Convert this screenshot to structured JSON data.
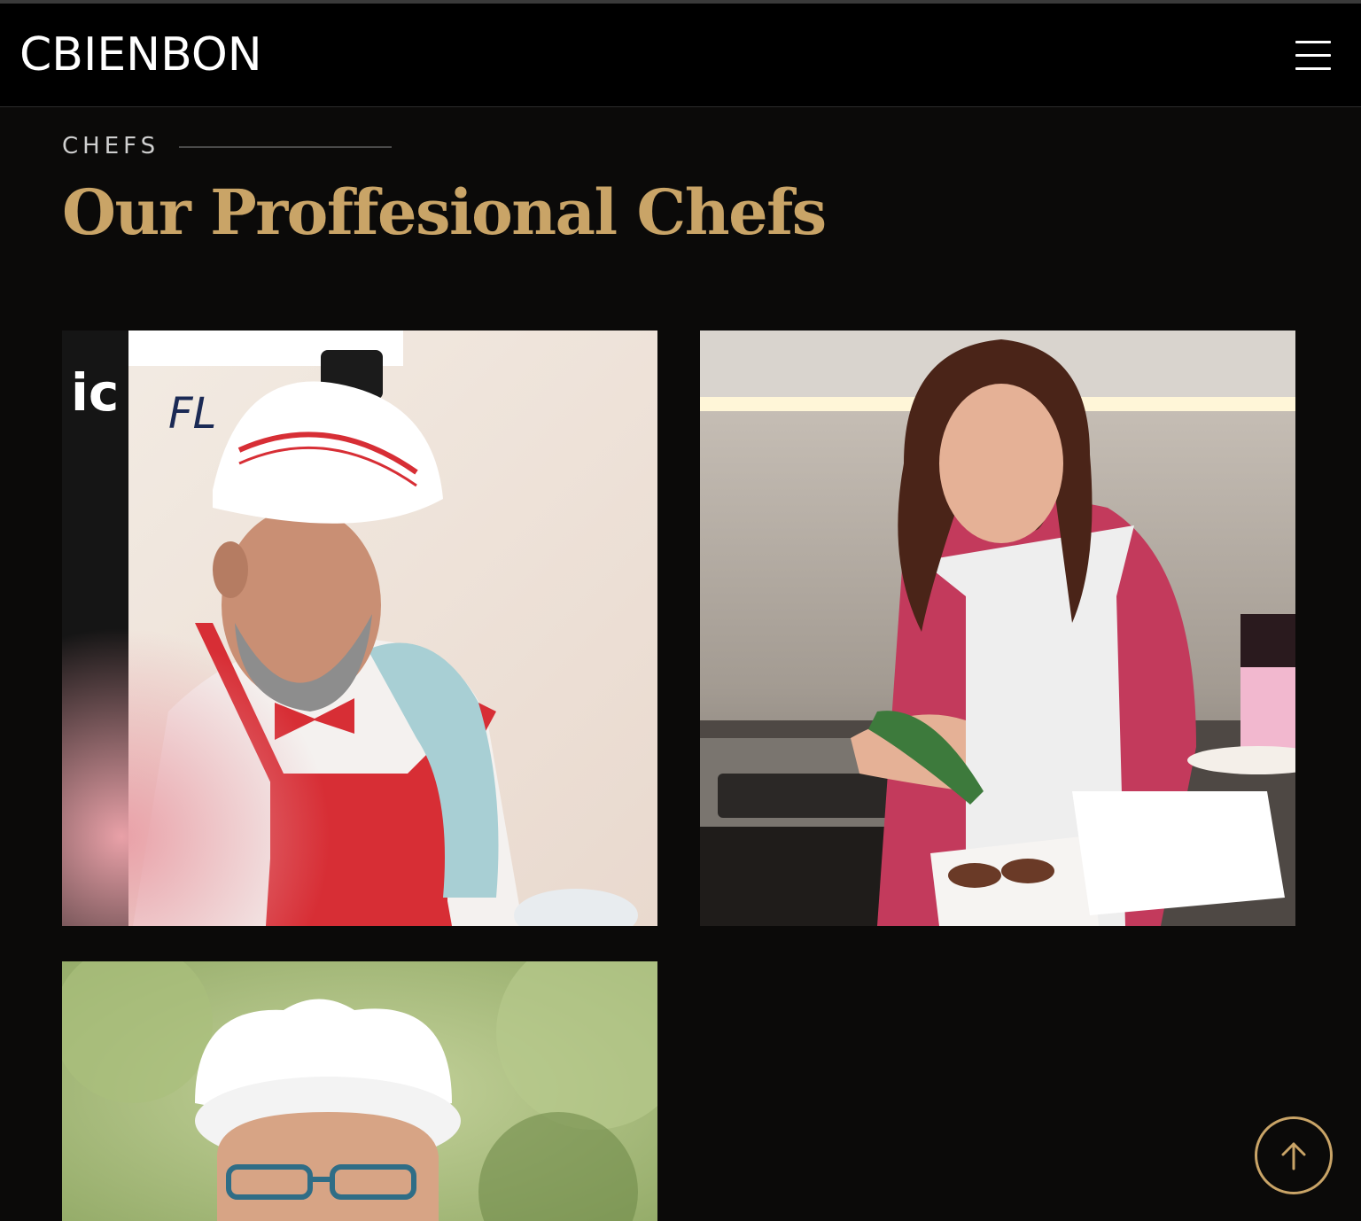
{
  "header": {
    "logo_text": "CBIENBON",
    "menu_icon": "hamburger-menu-icon"
  },
  "section": {
    "eyebrow": "CHEFS",
    "title": "Our Proffesional Chefs"
  },
  "chefs": [
    {
      "image": "chef-smiling-with-paper-hat-and-red-apron"
    },
    {
      "image": "woman-chef-decorating-cupcakes-in-kitchen"
    },
    {
      "image": "chef-with-toque-and-glasses-outdoors"
    }
  ],
  "scroll_top": {
    "icon": "arrow-up-icon"
  },
  "colors": {
    "accent": "#c9a467",
    "background": "#0b0a09",
    "header": "#000000"
  }
}
